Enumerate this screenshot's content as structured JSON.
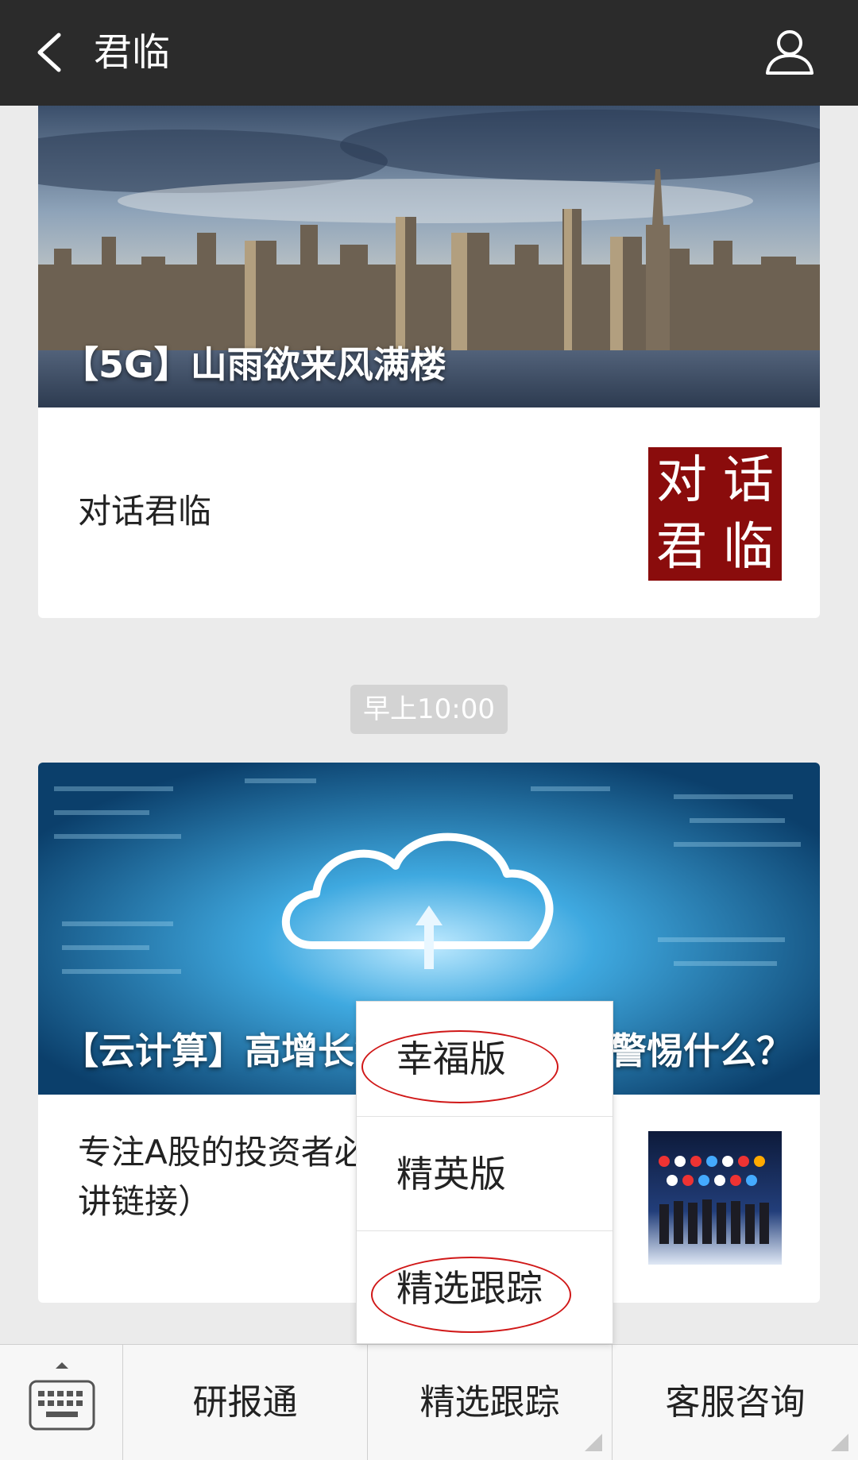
{
  "header": {
    "title": "君临"
  },
  "articles": [
    {
      "headline": "【5G】山雨欲来风满楼",
      "subtitle": "对话君临",
      "thumb_chars": [
        "对",
        "话",
        "君",
        "临"
      ]
    },
    {
      "headline": "【云计算】高增长背后，我们应该警惕什么？",
      "subtitle": "专注A股的投资者必读（文末附演讲链接）"
    }
  ],
  "timestamp": "早上10:00",
  "popup_menu": {
    "items": [
      "幸福版",
      "精英版",
      "精选跟踪"
    ],
    "circled_items": [
      "幸福版",
      "精选跟踪"
    ]
  },
  "bottom_menu": {
    "items": [
      "研报通",
      "精选跟踪",
      "客服咨询"
    ]
  },
  "colors": {
    "header_bg": "#2b2b2b",
    "page_bg": "#ebebeb",
    "annotation_red": "#d01818",
    "thumb_red": "#8a0c0c"
  }
}
